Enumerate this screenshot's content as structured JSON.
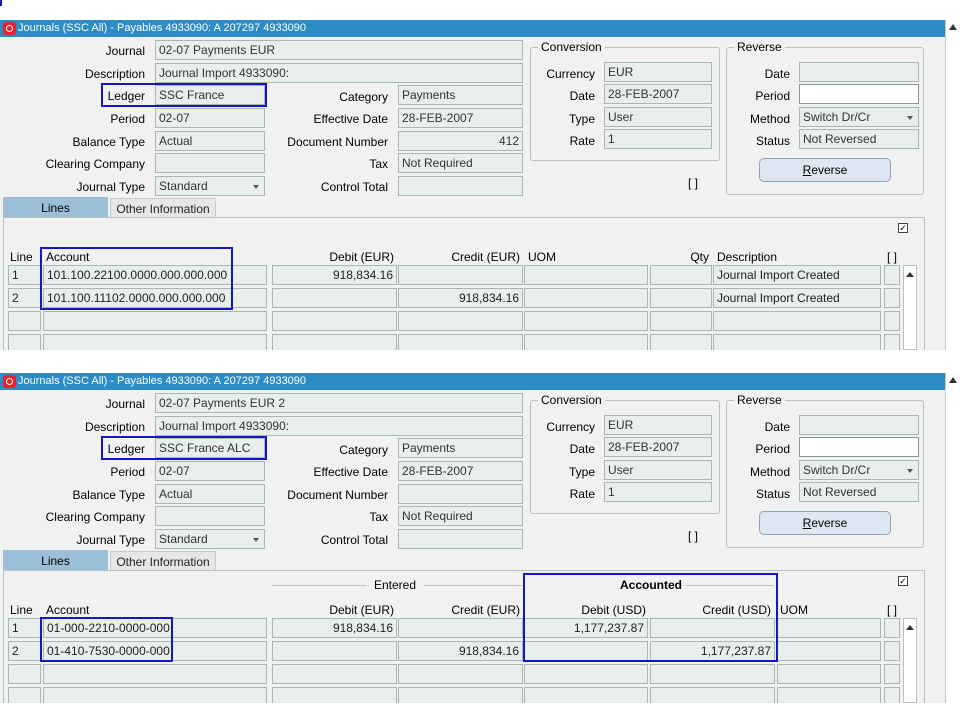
{
  "windows": [
    {
      "title": "Journals (SSC All) - Payables 4933090: A 207297 4933090",
      "labels": {
        "journal": "Journal",
        "description": "Description",
        "ledger": "Ledger",
        "period": "Period",
        "balance_type": "Balance Type",
        "clearing_company": "Clearing Company",
        "journal_type": "Journal Type",
        "category": "Category",
        "effective_date": "Effective Date",
        "document_number": "Document Number",
        "tax": "Tax",
        "control_total": "Control Total",
        "conversion": "Conversion",
        "currency": "Currency",
        "date": "Date",
        "type": "Type",
        "rate": "Rate",
        "reverse_group": "Reverse",
        "rev_date": "Date",
        "rev_period": "Period",
        "method": "Method",
        "status": "Status"
      },
      "values": {
        "journal": "02-07 Payments EUR",
        "description": "Journal Import 4933090:",
        "ledger": "SSC France",
        "period": "02-07",
        "balance_type": "Actual",
        "clearing_company": "",
        "journal_type": "Standard",
        "category": "Payments",
        "effective_date": "28-FEB-2007",
        "document_number": "412",
        "tax": "Not Required",
        "control_total": "",
        "currency": "EUR",
        "conv_date": "28-FEB-2007",
        "conv_type": "User",
        "rate": "1",
        "rev_date": "",
        "rev_period": "",
        "method": "Switch Dr/Cr",
        "status": "Not Reversed"
      },
      "reverse_button": "Reverse",
      "bracket_button": "[ ]",
      "tabs": [
        "Lines",
        "Other Information"
      ],
      "columns": {
        "line": "Line",
        "account": "Account",
        "debit": "Debit (EUR)",
        "credit": "Credit (EUR)",
        "uom": "UOM",
        "qty": "Qty",
        "description": "Description",
        "flag": "[ ]"
      },
      "rows": [
        {
          "line": "1",
          "account": "101.100.22100.0000.000.000.000",
          "debit": "918,834.16",
          "credit": "",
          "uom": "",
          "qty": "",
          "description": "Journal Import Created"
        },
        {
          "line": "2",
          "account": "101.100.11102.0000.000.000.000",
          "debit": "",
          "credit": "918,834.16",
          "uom": "",
          "qty": "",
          "description": "Journal Import Created"
        }
      ]
    },
    {
      "title": "Journals (SSC All) - Payables 4933090: A 207297 4933090",
      "labels": {
        "journal": "Journal",
        "description": "Description",
        "ledger": "Ledger",
        "period": "Period",
        "balance_type": "Balance Type",
        "clearing_company": "Clearing Company",
        "journal_type": "Journal Type",
        "category": "Category",
        "effective_date": "Effective Date",
        "document_number": "Document Number",
        "tax": "Tax",
        "control_total": "Control Total",
        "conversion": "Conversion",
        "currency": "Currency",
        "date": "Date",
        "type": "Type",
        "rate": "Rate",
        "reverse_group": "Reverse",
        "rev_date": "Date",
        "rev_period": "Period",
        "method": "Method",
        "status": "Status"
      },
      "values": {
        "journal": "02-07 Payments EUR 2",
        "description": "Journal Import 4933090:",
        "ledger": "SSC France ALC",
        "period": "02-07",
        "balance_type": "Actual",
        "clearing_company": "",
        "journal_type": "Standard",
        "category": "Payments",
        "effective_date": "28-FEB-2007",
        "document_number": "",
        "tax": "Not Required",
        "control_total": "",
        "currency": "EUR",
        "conv_date": "28-FEB-2007",
        "conv_type": "User",
        "rate": "1",
        "rev_date": "",
        "rev_period": "",
        "method": "Switch Dr/Cr",
        "status": "Not Reversed"
      },
      "reverse_button": "Reverse",
      "bracket_button": "[ ]",
      "tabs": [
        "Lines",
        "Other Information"
      ],
      "section_headers": {
        "entered": "Entered",
        "accounted": "Accounted"
      },
      "columns": {
        "line": "Line",
        "account": "Account",
        "debit": "Debit (EUR)",
        "credit": "Credit (EUR)",
        "acc_debit": "Debit (USD)",
        "acc_credit": "Credit (USD)",
        "uom": "UOM",
        "flag": "[ ]"
      },
      "rows": [
        {
          "line": "1",
          "account": "01-000-2210-0000-000",
          "debit": "918,834.16",
          "credit": "",
          "acc_debit": "1,177,237.87",
          "acc_credit": ""
        },
        {
          "line": "2",
          "account": "01-410-7530-0000-000",
          "debit": "",
          "credit": "918,834.16",
          "acc_debit": "",
          "acc_credit": "1,177,237.87"
        }
      ]
    }
  ],
  "colors": {
    "title_bar": "#2d8cc6",
    "highlight": "#1515c8",
    "field_bg": "#e8eeea",
    "active_tab": "#9cbfd8"
  }
}
